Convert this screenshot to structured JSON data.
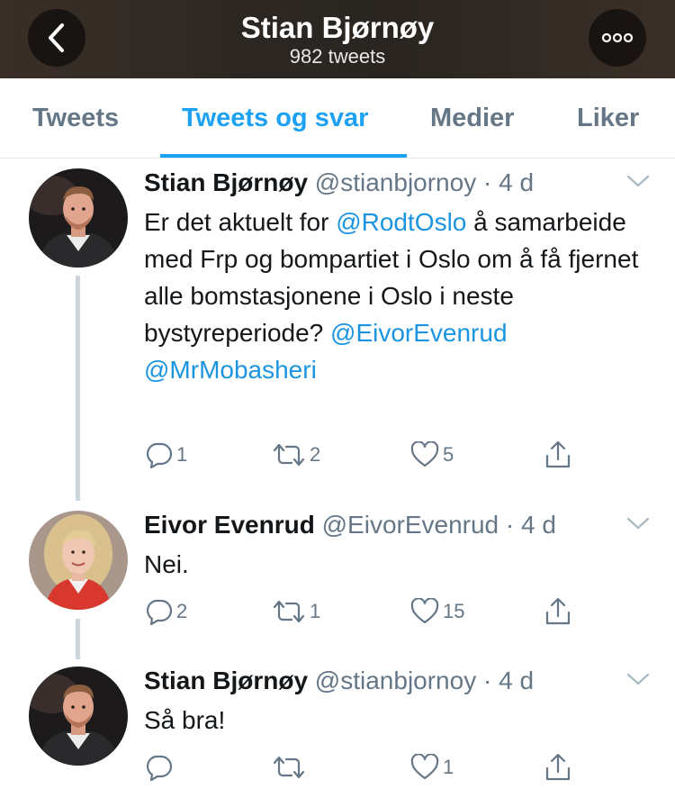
{
  "header": {
    "title": "Stian Bjørnøy",
    "subtitle": "982 tweets",
    "back_icon": "chevron-left-icon",
    "more_icon": "ellipsis-icon"
  },
  "tabs": [
    {
      "label": "Tweets",
      "active": false
    },
    {
      "label": "Tweets og svar",
      "active": true
    },
    {
      "label": "Medier",
      "active": false
    },
    {
      "label": "Liker",
      "active": false
    }
  ],
  "colors": {
    "accent": "#1da1f2",
    "mention": "#1b95e0",
    "muted": "#657786",
    "thread_line": "#ccd6dd"
  },
  "tweets": [
    {
      "name": "Stian Bjørnøy",
      "handle": "@stianbjornoy",
      "sep": "·",
      "time": "4 d",
      "text": {
        "t1": "Er det aktuelt for ",
        "m1": "@RodtOslo",
        "t2": " å samarbeide med Frp og bompartiet i Oslo om å få fjernet alle bomstasjonene i Oslo i neste bystyreperiode? ",
        "m2": "@EivorEvenrud",
        "m3": "@MrMobasheri"
      },
      "replies": "1",
      "retweets": "2",
      "likes": "5"
    },
    {
      "name": "Eivor Evenrud",
      "handle": "@EivorEvenrud",
      "sep": "·",
      "time": "4 d",
      "text": "Nei.",
      "replies": "2",
      "retweets": "1",
      "likes": "15"
    },
    {
      "name": "Stian Bjørnøy",
      "handle": "@stianbjornoy",
      "sep": "·",
      "time": "4 d",
      "text": "Så bra!",
      "replies": "",
      "retweets": "",
      "likes": "1"
    }
  ]
}
